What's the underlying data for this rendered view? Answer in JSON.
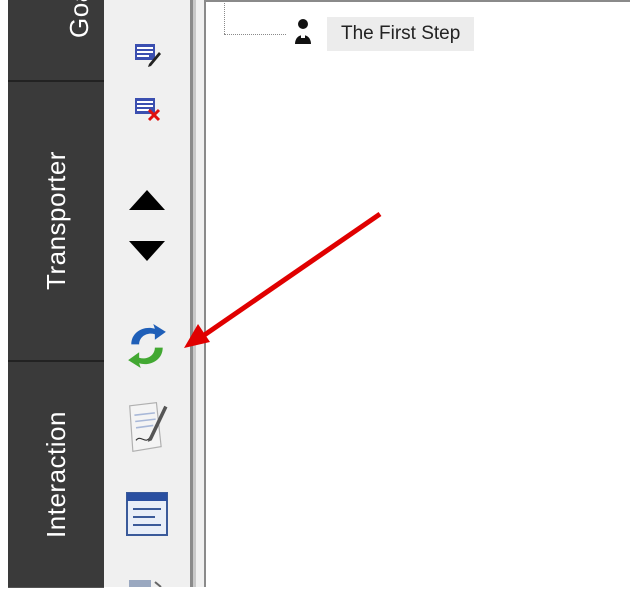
{
  "tabs": [
    {
      "id": "goals",
      "label": "Goa"
    },
    {
      "id": "transporter",
      "label": "Transporter"
    },
    {
      "id": "interaction",
      "label": "Interaction"
    }
  ],
  "toolbar": {
    "buttons": [
      {
        "name": "edit-list-icon"
      },
      {
        "name": "delete-list-icon"
      },
      {
        "name": "move-up-icon"
      },
      {
        "name": "move-down-icon"
      },
      {
        "name": "refresh-icon"
      },
      {
        "name": "sign-document-icon"
      },
      {
        "name": "properties-window-icon"
      },
      {
        "name": "partial-icon"
      }
    ]
  },
  "tree": {
    "node_label": "The First Step"
  },
  "annotation": {
    "arrow_color": "#e00000"
  }
}
